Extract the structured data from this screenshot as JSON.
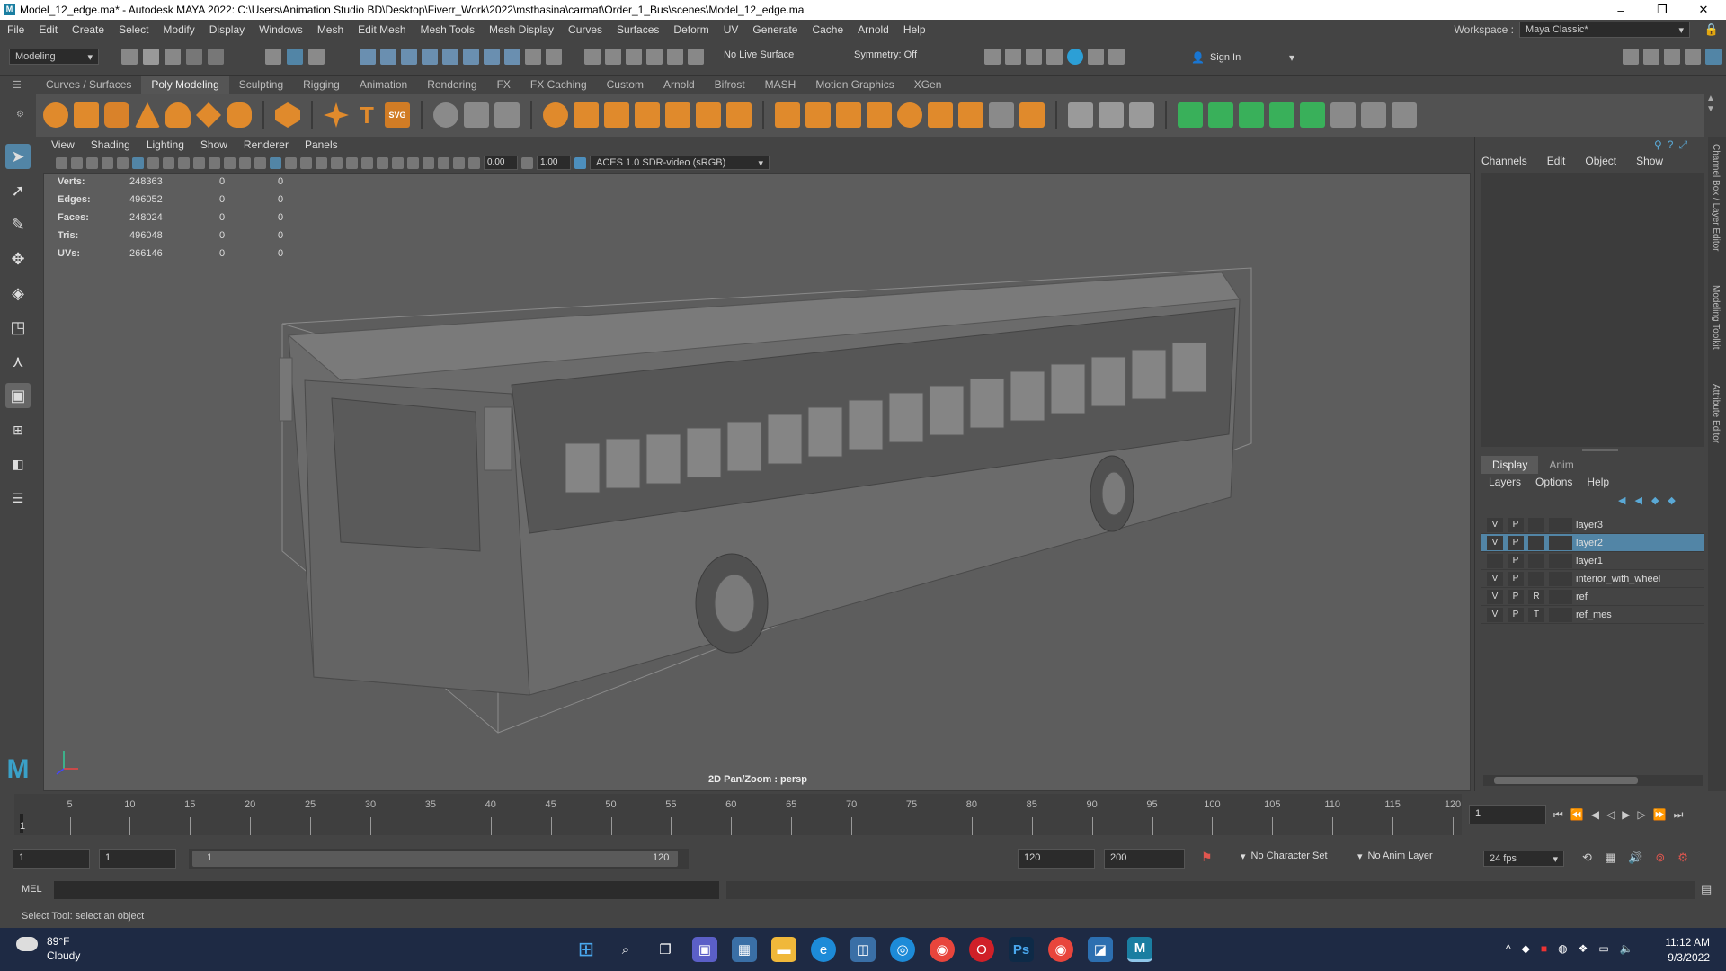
{
  "window": {
    "title": "Model_12_edge.ma* - Autodesk MAYA 2022: C:\\Users\\Animation Studio BD\\Desktop\\Fiverr_Work\\2022\\msthasina\\carmat\\Order_1_Bus\\scenes\\Model_12_edge.ma",
    "minimize": "–",
    "maximize": "❐",
    "close": "✕"
  },
  "menubar": {
    "items": [
      "File",
      "Edit",
      "Create",
      "Select",
      "Modify",
      "Display",
      "Windows",
      "Mesh",
      "Edit Mesh",
      "Mesh Tools",
      "Mesh Display",
      "Curves",
      "Surfaces",
      "Deform",
      "UV",
      "Generate",
      "Cache",
      "Arnold",
      "Help"
    ],
    "workspace_label": "Workspace :",
    "workspace_value": "Maya Classic*"
  },
  "statusline": {
    "mode": "Modeling",
    "live_surface": "No Live Surface",
    "symmetry": "Symmetry: Off",
    "sign_in": "Sign In"
  },
  "shelf": {
    "tabs": [
      "Curves / Surfaces",
      "Poly Modeling",
      "Sculpting",
      "Rigging",
      "Animation",
      "Rendering",
      "FX",
      "FX Caching",
      "Custom",
      "Arnold",
      "Bifrost",
      "MASH",
      "Motion Graphics",
      "XGen"
    ],
    "active_tab": "Poly Modeling",
    "svg_label": "SVG",
    "text_label": "T"
  },
  "viewport": {
    "menu": [
      "View",
      "Shading",
      "Lighting",
      "Show",
      "Renderer",
      "Panels"
    ],
    "near_value": "0.00",
    "exposure_value": "1.00",
    "color_space": "ACES 1.0 SDR-video (sRGB)",
    "camera_label": "2D Pan/Zoom : persp",
    "hud": [
      {
        "label": "Verts:",
        "value": "248363",
        "a": "0",
        "b": "0"
      },
      {
        "label": "Edges:",
        "value": "496052",
        "a": "0",
        "b": "0"
      },
      {
        "label": "Faces:",
        "value": "248024",
        "a": "0",
        "b": "0"
      },
      {
        "label": "Tris:",
        "value": "496048",
        "a": "0",
        "b": "0"
      },
      {
        "label": "UVs:",
        "value": "266146",
        "a": "0",
        "b": "0"
      }
    ]
  },
  "channelbox": {
    "menu": [
      "Channels",
      "Edit",
      "Object",
      "Show"
    ],
    "side_tabs": [
      "Channel Box / Layer Editor",
      "Modeling Toolkit",
      "Attribute Editor"
    ]
  },
  "layer_editor": {
    "tabs": [
      "Display",
      "Anim"
    ],
    "active_tab": "Display",
    "menu": [
      "Layers",
      "Options",
      "Help"
    ],
    "layers": [
      {
        "v": "V",
        "p": "P",
        "t": "",
        "name": "layer3",
        "selected": false
      },
      {
        "v": "V",
        "p": "P",
        "t": "",
        "name": "layer2",
        "selected": true
      },
      {
        "v": "",
        "p": "P",
        "t": "",
        "name": "layer1",
        "selected": false
      },
      {
        "v": "V",
        "p": "P",
        "t": "",
        "name": "interior_with_wheel",
        "selected": false
      },
      {
        "v": "V",
        "p": "P",
        "t": "R",
        "name": "ref",
        "selected": false
      },
      {
        "v": "V",
        "p": "P",
        "t": "T",
        "name": "ref_mes",
        "selected": false
      }
    ]
  },
  "timeline": {
    "ticks": [
      "5",
      "10",
      "15",
      "20",
      "25",
      "30",
      "35",
      "40",
      "45",
      "50",
      "55",
      "60",
      "65",
      "70",
      "75",
      "80",
      "85",
      "90",
      "95",
      "100",
      "105",
      "110",
      "115",
      "120"
    ],
    "start_marker": "1",
    "current_frame": "1"
  },
  "range": {
    "start": "1",
    "anim_start": "1",
    "slider_start": "1",
    "slider_end": "120",
    "anim_end": "120",
    "end": "200",
    "character_set": "No Character Set",
    "anim_layer": "No Anim Layer",
    "fps": "24 fps"
  },
  "command": {
    "mel_label": "MEL",
    "help_text": "Select Tool: select an object"
  },
  "taskbar": {
    "weather_temp": "89°F",
    "weather_desc": "Cloudy",
    "time": "11:12 AM",
    "date": "9/3/2022",
    "ps_label": "Ps",
    "maya_label": "M"
  },
  "colors": {
    "accent": "#5285a6",
    "viewport_bg": "#5d5d5d",
    "taskbar": "#1e2a44"
  }
}
